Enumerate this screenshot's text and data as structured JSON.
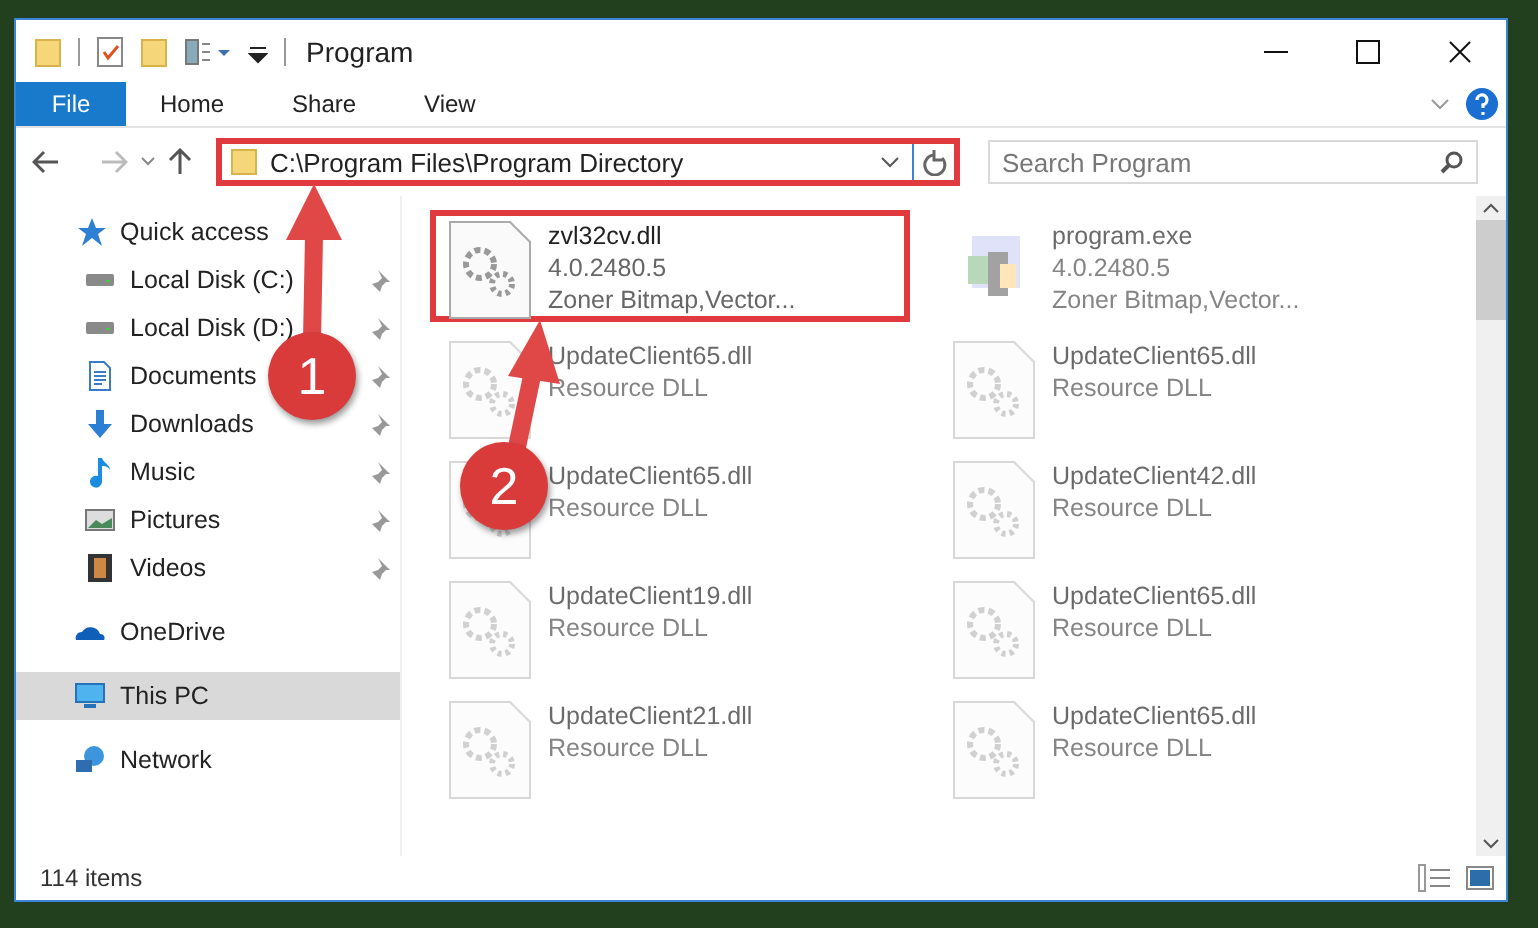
{
  "window": {
    "title": "Program"
  },
  "ribbon_tabs": [
    {
      "label": "File",
      "selected": true
    },
    {
      "label": "Home",
      "selected": false
    },
    {
      "label": "Share",
      "selected": false
    },
    {
      "label": "View",
      "selected": false
    }
  ],
  "address": {
    "path": "C:\\Program Files\\Program Directory",
    "highlighted": true
  },
  "search": {
    "placeholder": "Search Program"
  },
  "sidebar": {
    "items": [
      {
        "label": "Quick access",
        "kind": "star",
        "selected": false,
        "children": [
          {
            "label": "Local Disk (C:)",
            "kind": "drive",
            "pinned": true,
            "selected": false
          },
          {
            "label": "Local Disk (D:)",
            "kind": "drive",
            "pinned": true,
            "selected": false
          },
          {
            "label": "Documents",
            "kind": "document",
            "pinned": true,
            "selected": false
          },
          {
            "label": "Downloads",
            "kind": "download",
            "pinned": true,
            "selected": false
          },
          {
            "label": "Music",
            "kind": "music",
            "pinned": true,
            "selected": false
          },
          {
            "label": "Pictures",
            "kind": "pictures",
            "pinned": true,
            "selected": false
          },
          {
            "label": "Videos",
            "kind": "videos",
            "pinned": true,
            "selected": false
          }
        ]
      },
      {
        "label": "OneDrive",
        "kind": "cloud",
        "selected": false
      },
      {
        "label": "This PC",
        "kind": "pc",
        "selected": true
      },
      {
        "label": "Network",
        "kind": "network",
        "selected": false
      }
    ]
  },
  "files": [
    {
      "kind": "dll",
      "name": "zvl32cv.dll",
      "lines": [
        "4.0.2480.5",
        "Zoner Bitmap,Vector..."
      ],
      "blurred": false,
      "highlighted": true
    },
    {
      "kind": "exe",
      "name": "program.exe",
      "lines": [
        "4.0.2480.5",
        "Zoner Bitmap,Vector..."
      ],
      "blurred": true,
      "highlighted": false
    },
    {
      "kind": "dll",
      "name": "UpdateClient65.dll",
      "lines": [
        "Resource DLL"
      ],
      "blurred": true,
      "highlighted": false
    },
    {
      "kind": "dll",
      "name": "UpdateClient65.dll",
      "lines": [
        "Resource DLL"
      ],
      "blurred": true,
      "highlighted": false
    },
    {
      "kind": "dll",
      "name": "UpdateClient65.dll",
      "lines": [
        "Resource DLL"
      ],
      "blurred": true,
      "highlighted": false
    },
    {
      "kind": "dll",
      "name": "UpdateClient42.dll",
      "lines": [
        "Resource DLL"
      ],
      "blurred": true,
      "highlighted": false
    },
    {
      "kind": "dll",
      "name": "UpdateClient19.dll",
      "lines": [
        "Resource DLL"
      ],
      "blurred": true,
      "highlighted": false
    },
    {
      "kind": "dll",
      "name": "UpdateClient65.dll",
      "lines": [
        "Resource DLL"
      ],
      "blurred": true,
      "highlighted": false
    },
    {
      "kind": "dll",
      "name": "UpdateClient21.dll",
      "lines": [
        "Resource DLL"
      ],
      "blurred": true,
      "highlighted": false
    },
    {
      "kind": "dll",
      "name": "UpdateClient65.dll",
      "lines": [
        "Resource DLL"
      ],
      "blurred": true,
      "highlighted": false
    }
  ],
  "status_bar": {
    "count": "114 items"
  },
  "callouts": [
    {
      "number": "1"
    },
    {
      "number": "2"
    }
  ]
}
